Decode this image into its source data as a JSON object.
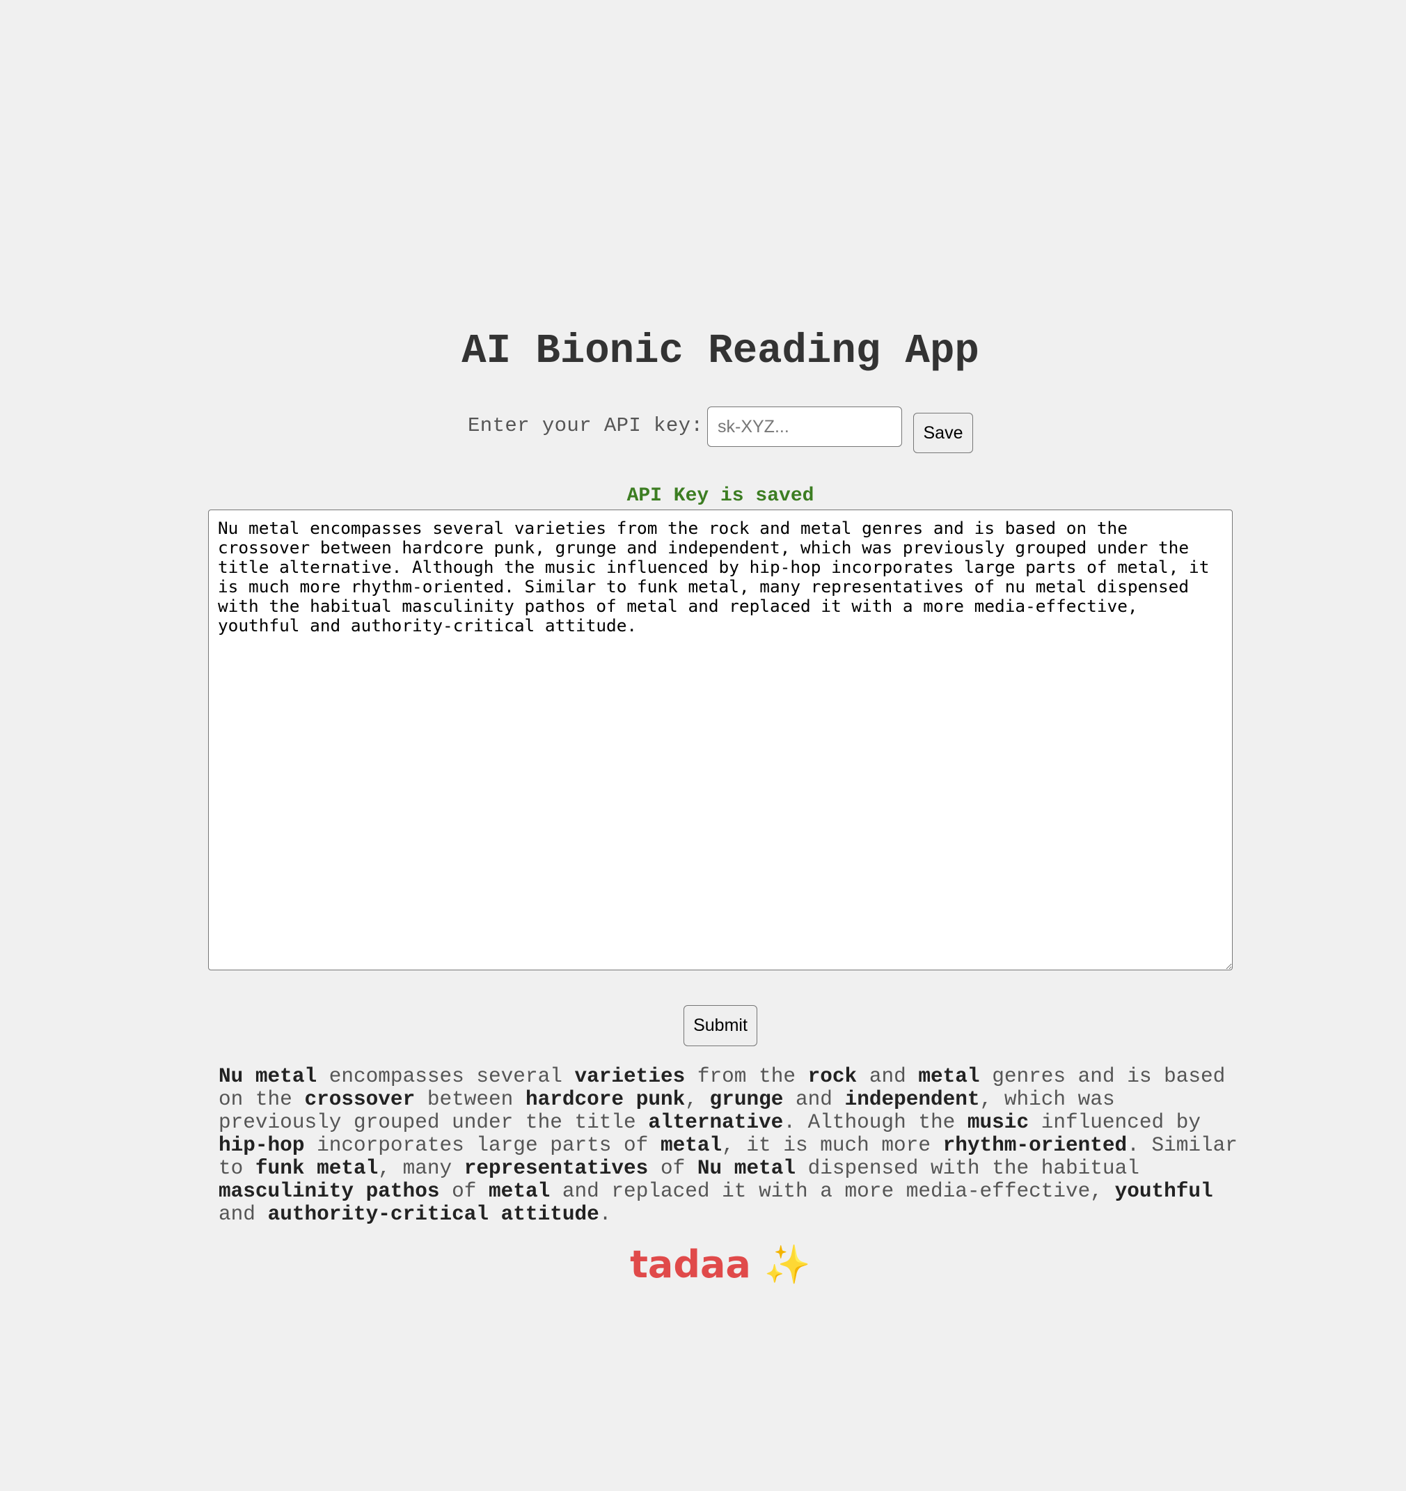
{
  "app": {
    "title": "AI Bionic Reading App"
  },
  "api_key": {
    "label": "Enter your API key:",
    "placeholder": "sk-XYZ...",
    "value": "",
    "save_label": "Save",
    "status": "API Key is saved"
  },
  "input": {
    "text": "Nu metal encompasses several varieties from the rock and metal genres and is based on the crossover between hardcore punk, grunge and independent, which was previously grouped under the title alternative. Although the music influenced by hip-hop incorporates large parts of metal, it is much more rhythm-oriented. Similar to funk metal, many representatives of nu metal dispensed with the habitual masculinity pathos of metal and replaced it with a more media-effective, youthful and authority-critical attitude."
  },
  "submit_label": "Submit",
  "output": {
    "segments": [
      {
        "text": "Nu metal",
        "bold": true
      },
      {
        "text": " encompasses several ",
        "bold": false
      },
      {
        "text": "varieties",
        "bold": true
      },
      {
        "text": " from the ",
        "bold": false
      },
      {
        "text": "rock",
        "bold": true
      },
      {
        "text": " and ",
        "bold": false
      },
      {
        "text": "metal",
        "bold": true
      },
      {
        "text": " genres and is based on the ",
        "bold": false
      },
      {
        "text": "crossover",
        "bold": true
      },
      {
        "text": " between ",
        "bold": false
      },
      {
        "text": "hardcore punk",
        "bold": true
      },
      {
        "text": ", ",
        "bold": false
      },
      {
        "text": "grunge",
        "bold": true
      },
      {
        "text": " and ",
        "bold": false
      },
      {
        "text": "independent",
        "bold": true
      },
      {
        "text": ", which was previously grouped under the title ",
        "bold": false
      },
      {
        "text": "alternative",
        "bold": true
      },
      {
        "text": ". Although the ",
        "bold": false
      },
      {
        "text": "music",
        "bold": true
      },
      {
        "text": " influenced by ",
        "bold": false
      },
      {
        "text": "hip-hop",
        "bold": true
      },
      {
        "text": " incorporates large parts of ",
        "bold": false
      },
      {
        "text": "metal",
        "bold": true
      },
      {
        "text": ", it is much more ",
        "bold": false
      },
      {
        "text": "rhythm-oriented",
        "bold": true
      },
      {
        "text": ". Similar to ",
        "bold": false
      },
      {
        "text": "funk metal",
        "bold": true
      },
      {
        "text": ", many ",
        "bold": false
      },
      {
        "text": "representatives",
        "bold": true
      },
      {
        "text": " of ",
        "bold": false
      },
      {
        "text": "Nu metal",
        "bold": true
      },
      {
        "text": " dispensed with the habitual ",
        "bold": false
      },
      {
        "text": "masculinity pathos",
        "bold": true
      },
      {
        "text": " of ",
        "bold": false
      },
      {
        "text": "metal",
        "bold": true
      },
      {
        "text": " and replaced it with a more media-effective, ",
        "bold": false
      },
      {
        "text": "youthful",
        "bold": true
      },
      {
        "text": " and ",
        "bold": false
      },
      {
        "text": "authority-critical attitude",
        "bold": true
      },
      {
        "text": ".",
        "bold": false
      }
    ]
  },
  "footer": {
    "text": "tadaa",
    "emoji": "✨",
    "emoji_icon": "sparkles-icon"
  },
  "colors": {
    "background": "#f0f0f0",
    "status_green": "#3c7d22",
    "tadaa_red": "#e04a4a"
  }
}
